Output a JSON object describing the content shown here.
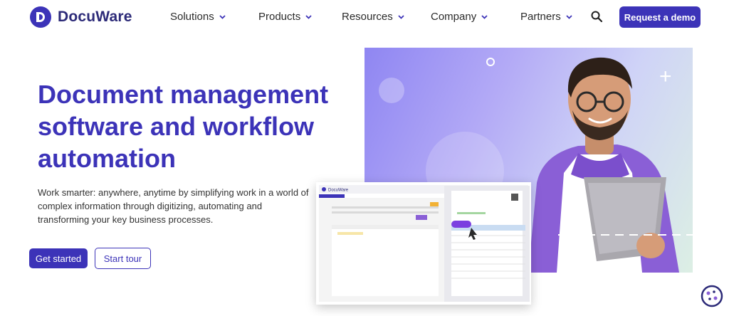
{
  "brand": {
    "name": "DocuWare"
  },
  "nav": {
    "items": [
      {
        "label": "Solutions"
      },
      {
        "label": "Products"
      },
      {
        "label": "Resources"
      },
      {
        "label": "Company"
      },
      {
        "label": "Partners"
      }
    ],
    "cta_label": "Request a demo"
  },
  "hero": {
    "title": "Document management software and workflow automation",
    "subtitle": "Work smarter: anywhere, anytime by simplifying work in a world of complex information through digitizing, automating and transforming your key business processes.",
    "primary_button": "Get started",
    "secondary_button": "Start tour"
  },
  "mockup": {
    "app_name": "DocuWare"
  },
  "icons": [
    "search-icon",
    "chevron-down-icon",
    "cookie-icon",
    "cursor-icon"
  ],
  "colors": {
    "brand": "#3c33b8",
    "brand_dark": "#2c2a78",
    "panel_purple": "#8f86f2",
    "panel_mint": "#dcefe4",
    "shirt": "#8a5fd6"
  }
}
